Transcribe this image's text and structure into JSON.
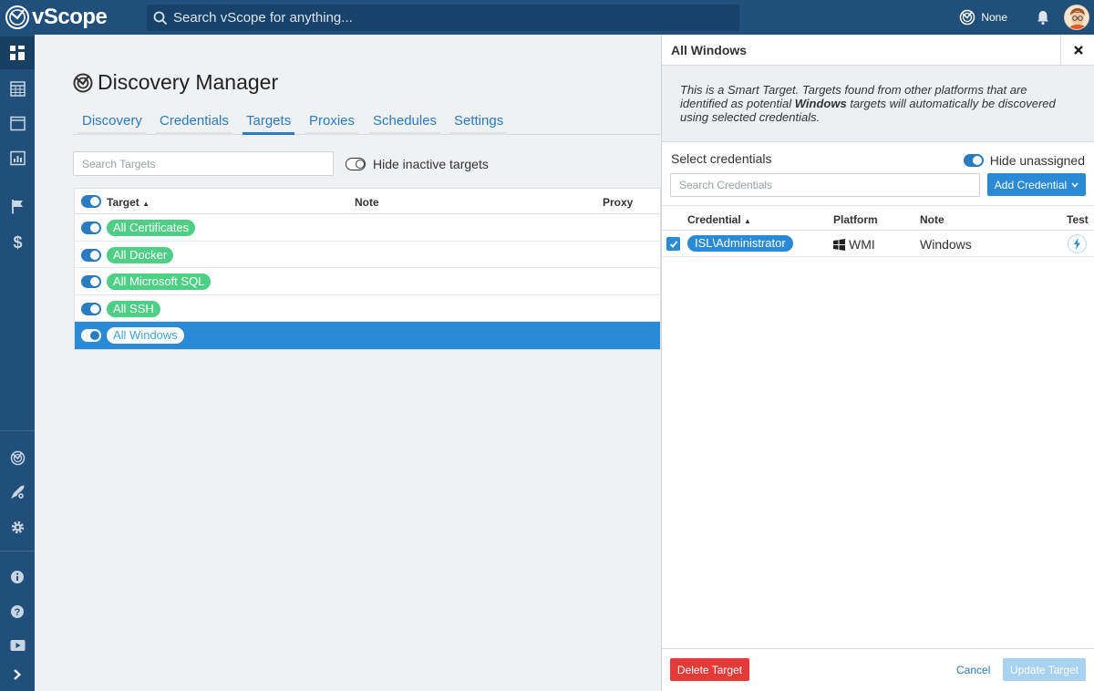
{
  "app": {
    "name": "vScope"
  },
  "topbar": {
    "search_placeholder": "Search vScope for anything...",
    "site_label": "None"
  },
  "page": {
    "title": "Discovery Manager"
  },
  "tabs": [
    {
      "label": "Discovery",
      "active": false
    },
    {
      "label": "Credentials",
      "active": false
    },
    {
      "label": "Targets",
      "active": true
    },
    {
      "label": "Proxies",
      "active": false
    },
    {
      "label": "Schedules",
      "active": false
    },
    {
      "label": "Settings",
      "active": false
    }
  ],
  "targets": {
    "search_placeholder": "Search Targets",
    "hide_inactive_label": "Hide inactive targets",
    "hide_inactive": false,
    "columns": {
      "target": "Target",
      "note": "Note",
      "proxy": "Proxy"
    },
    "rows": [
      {
        "name": "All Certificates",
        "active": true,
        "selected": false
      },
      {
        "name": "All Docker",
        "active": true,
        "selected": false
      },
      {
        "name": "All Microsoft SQL",
        "active": true,
        "selected": false
      },
      {
        "name": "All SSH",
        "active": true,
        "selected": false
      },
      {
        "name": "All Windows",
        "active": true,
        "selected": true
      }
    ]
  },
  "panel": {
    "title": "All Windows",
    "note_before": "This is a Smart Target. Targets found from other platforms that are identified as potential ",
    "note_bold": "Windows",
    "note_after": " targets will automatically be discovered using selected credentials.",
    "select_label": "Select credentials",
    "hide_unassigned_label": "Hide unassigned",
    "hide_unassigned": true,
    "search_placeholder": "Search Credentials",
    "add_button": "Add Credential",
    "columns": {
      "credential": "Credential",
      "platform": "Platform",
      "note": "Note",
      "test": "Test"
    },
    "credentials": [
      {
        "name": "ISL\\Administrator",
        "platform": "WMI",
        "note": "Windows",
        "checked": true
      }
    ],
    "delete_button": "Delete Target",
    "cancel_button": "Cancel",
    "update_button": "Update Target"
  },
  "colors": {
    "brand": "#1f4f7a",
    "accent": "#2a8ad6",
    "target_pill": "#4fce85",
    "danger": "#e53b38"
  }
}
